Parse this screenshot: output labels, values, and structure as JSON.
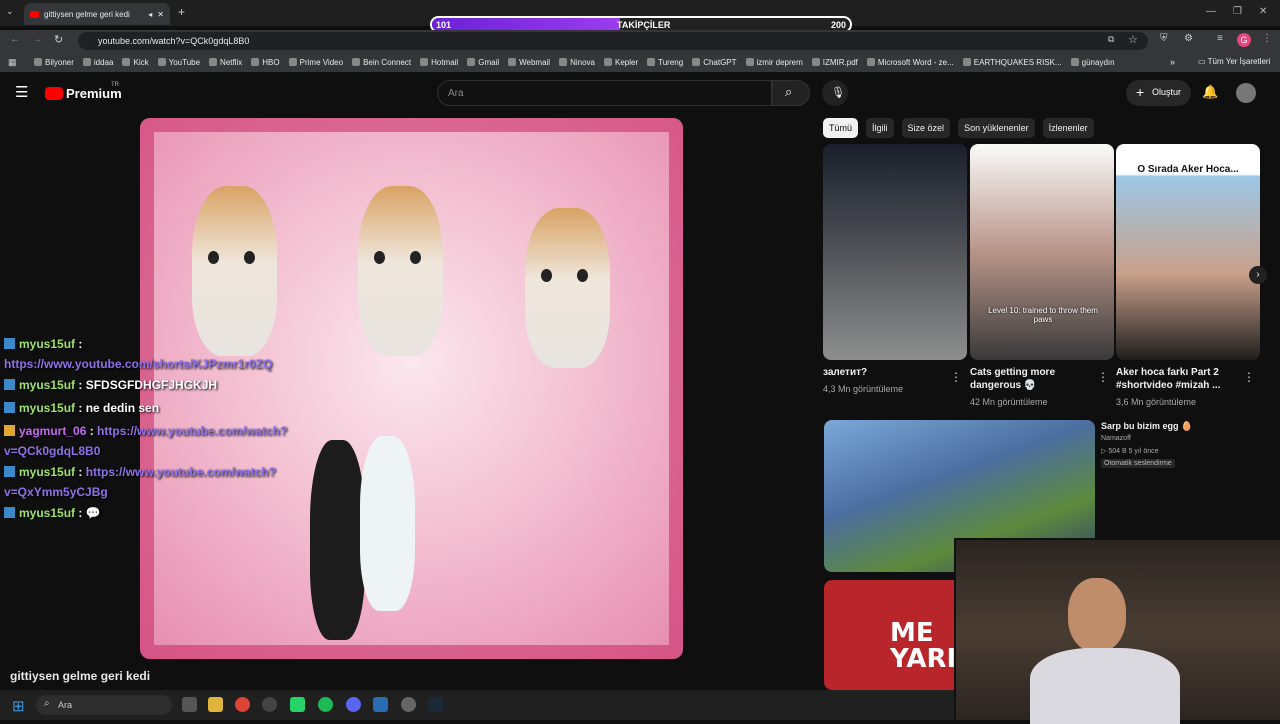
{
  "browser": {
    "tab_title": "gittiysen gelme geri kedi",
    "url": "youtube.com/watch?v=QCk0gdqL8B0",
    "new_tab": "+",
    "bookmarks": [
      "Bilyoner",
      "iddaa",
      "Kick",
      "YouTube",
      "Netflix",
      "HBO",
      "Prime Video",
      "Bein Connect",
      "Hotmail",
      "Gmail",
      "Webmail",
      "Ninova",
      "Kepler",
      "Tureng",
      "ChatGPT",
      "izmir deprem",
      "IZMIR.pdf",
      "Microsoft Word - ze...",
      "EARTHQUAKES RISK...",
      "günaydın"
    ],
    "all_bookmarks": "Tüm Yer İşaretleri",
    "profile_letter": "G"
  },
  "goal_bar": {
    "label": "TAKİPÇİLER",
    "current": "101",
    "target": "200",
    "progress": 0.45
  },
  "youtube": {
    "logo": "Premium",
    "logo_sup": "TR",
    "search_placeholder": "Ara",
    "create_label": "Oluştur",
    "chips": [
      "Tümü",
      "İlgili",
      "Size özel",
      "Son yüklenenler",
      "İzlenenler"
    ],
    "video_title": "gittiysen gelme geri kedi",
    "shorts": [
      {
        "title": "залетит?",
        "views": "4,3 Mn görüntüleme"
      },
      {
        "title": "Cats getting more dangerous 💀",
        "views": "42 Mn görüntüleme",
        "overlay": "Level 10: trained to throw them paws"
      },
      {
        "title": "Aker hoca farkı Part 2 #shortvideo #mizah ...",
        "views": "3,6 Mn görüntüleme",
        "overlay": "O Sırada Aker Hoca..."
      }
    ],
    "recommended": {
      "title": "Sarp bu bizim egg 🥚",
      "channel": "Namazoff",
      "meta": "▷ 504 B  5 yıl önce",
      "badge": "Otomatik seslendirme"
    },
    "lv2_text": "ME YARI"
  },
  "chat": [
    {
      "user": "myus15uf",
      "message": "",
      "link": "https://www.youtube.com/shorts/KJPzmr1r0ZQ"
    },
    {
      "user": "myus15uf",
      "message": "SFDSGFDHGFJHGKJH",
      "link": ""
    },
    {
      "user": "myus15uf",
      "message": "ne dedin sen",
      "link": ""
    },
    {
      "user": "yagmurt_06",
      "message": "",
      "link": "https://www.youtube.com/watch?",
      "link2": "v=QCk0gdqL8B0"
    },
    {
      "user": "myus15uf",
      "message": "",
      "link": "https://www.youtube.com/watch?",
      "link2": "v=QxYmm5yCJBg"
    },
    {
      "user": "myus15uf",
      "message": "💬",
      "link": ""
    }
  ],
  "taskbar": {
    "search": "Ara"
  }
}
